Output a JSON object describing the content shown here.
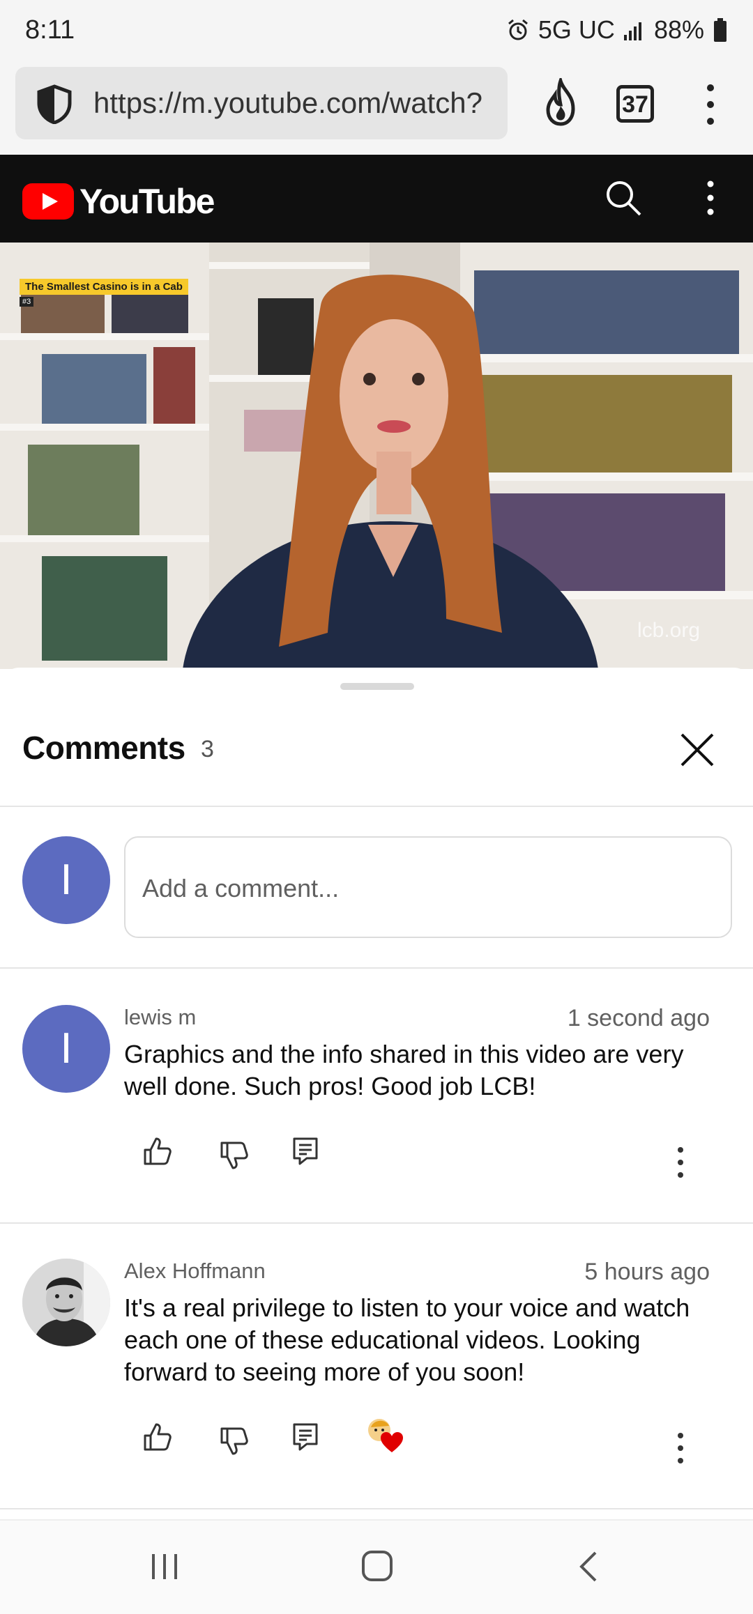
{
  "status_bar": {
    "time": "8:11",
    "network": "5G UC",
    "battery": "88%"
  },
  "browser": {
    "url": "https://m.youtube.com/watch?",
    "tab_count": "37"
  },
  "youtube": {
    "logo_text": "YouTube"
  },
  "video": {
    "overlay_label": "The Smallest Casino is in a Cab",
    "overlay_badge": "#3",
    "watermark": "lcb.org"
  },
  "comments": {
    "title": "Comments",
    "count": "3",
    "input_placeholder": "Add a comment...",
    "user_initial": "I",
    "items": [
      {
        "avatar_initial": "I",
        "author": "lewis m",
        "time": "1 second ago",
        "text": "Graphics and the info shared in this video are very well done.  Such pros!  Good job LCB!"
      },
      {
        "author": "Alex Hoffmann",
        "time": "5 hours ago",
        "text": "It's a real privilege to listen to your voice and watch each one of these educational videos. Looking forward to seeing more of you soon!"
      }
    ]
  },
  "colors": {
    "youtube_red": "#ff0000",
    "avatar_blue": "#5c6bc0",
    "header_black": "#0f0f0f"
  }
}
